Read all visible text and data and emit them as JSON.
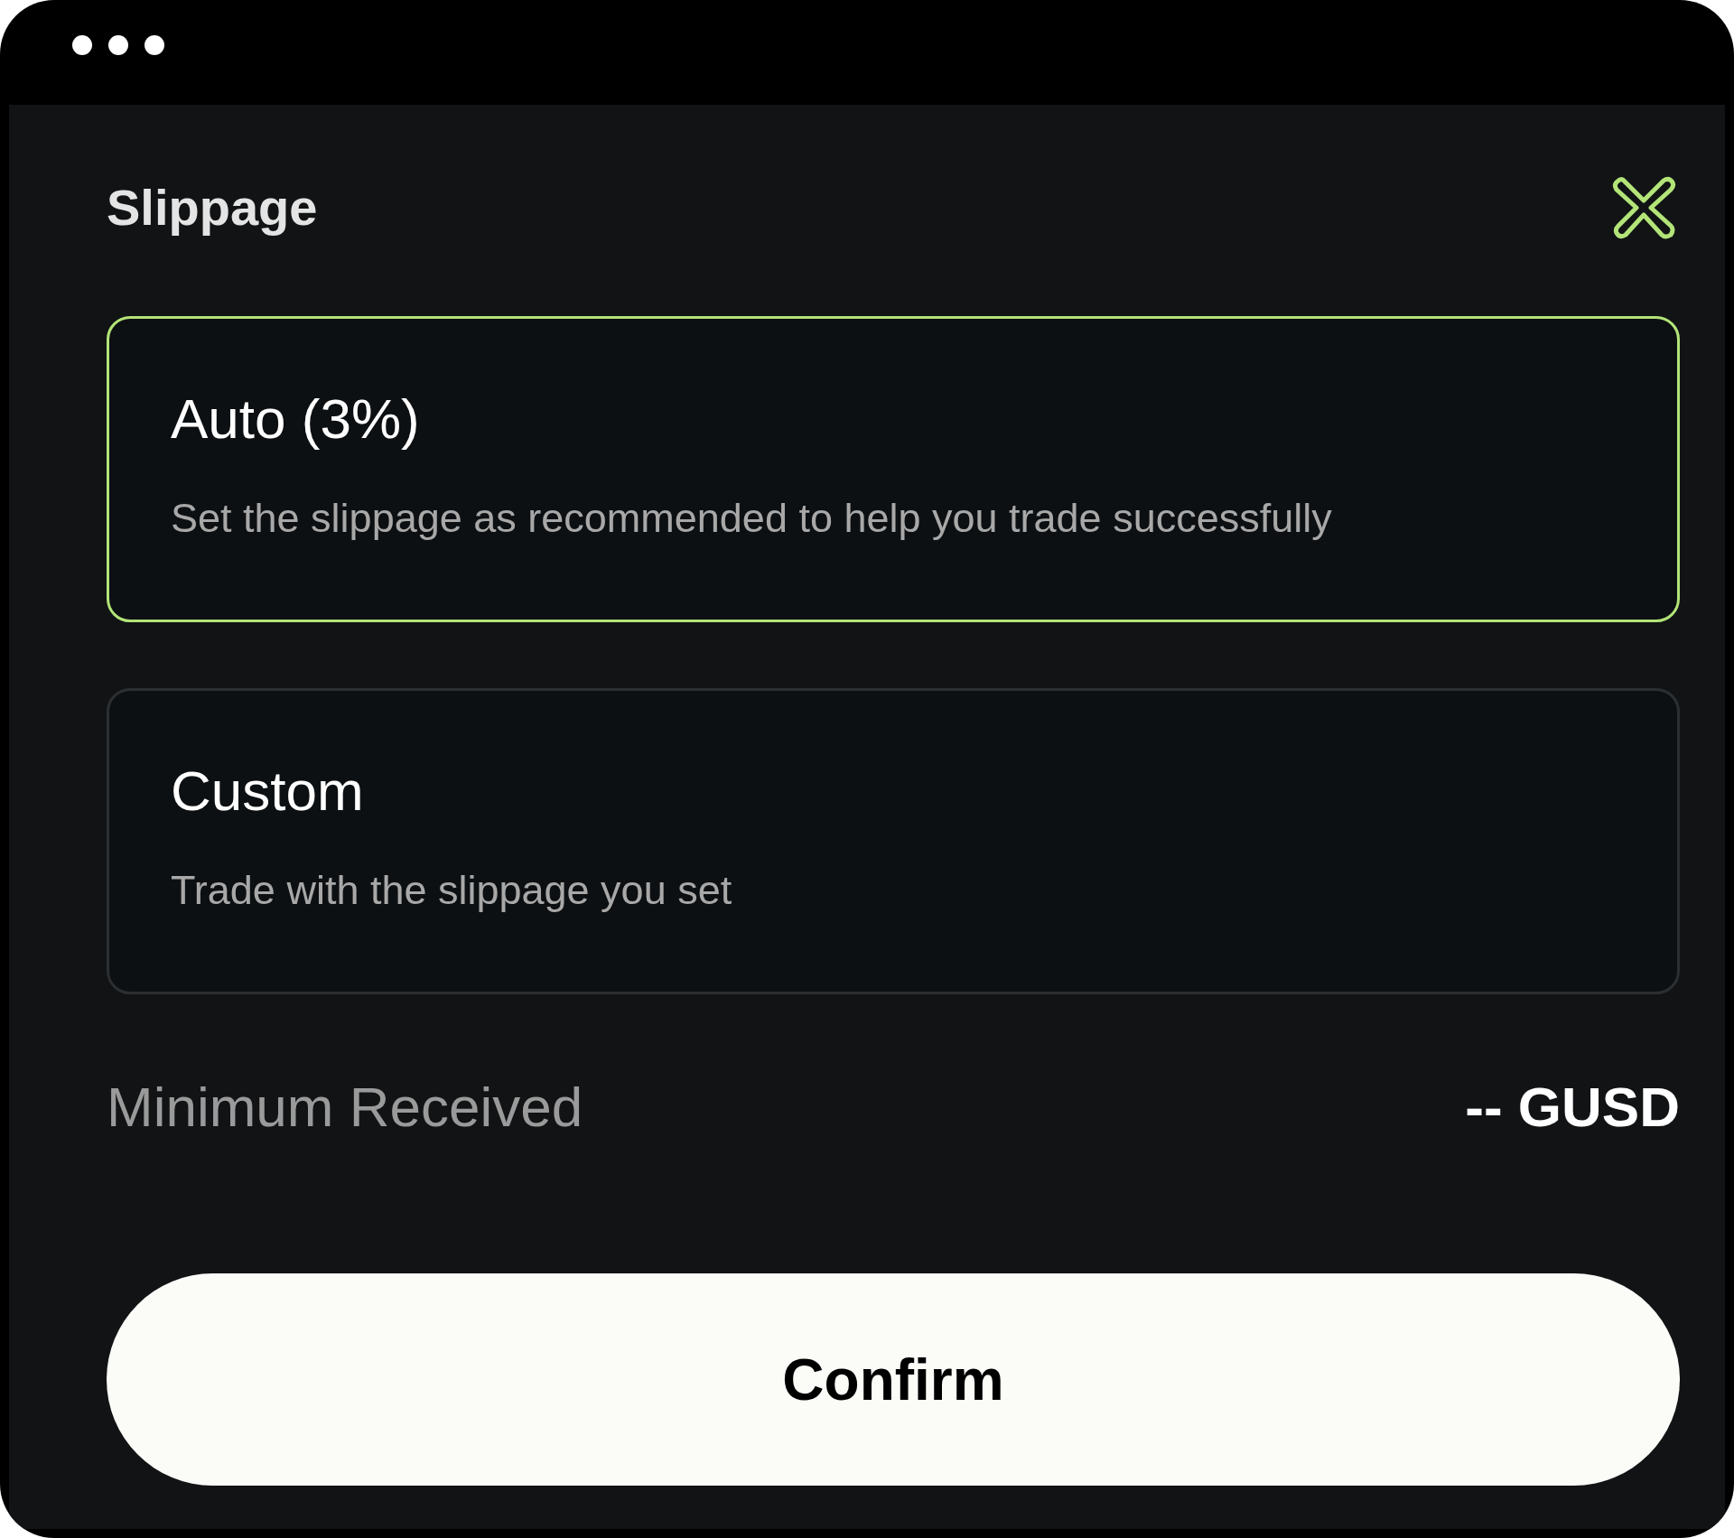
{
  "window": {
    "title": "Slippage"
  },
  "options": [
    {
      "title": "Auto (3%)",
      "description": "Set the slippage as recommended to help you trade successfully",
      "selected": true
    },
    {
      "title": "Custom",
      "description": "Trade with the slippage you set",
      "selected": false
    }
  ],
  "minimum_received": {
    "label": "Minimum Received",
    "value": "-- GUSD"
  },
  "confirm_button": "Confirm"
}
